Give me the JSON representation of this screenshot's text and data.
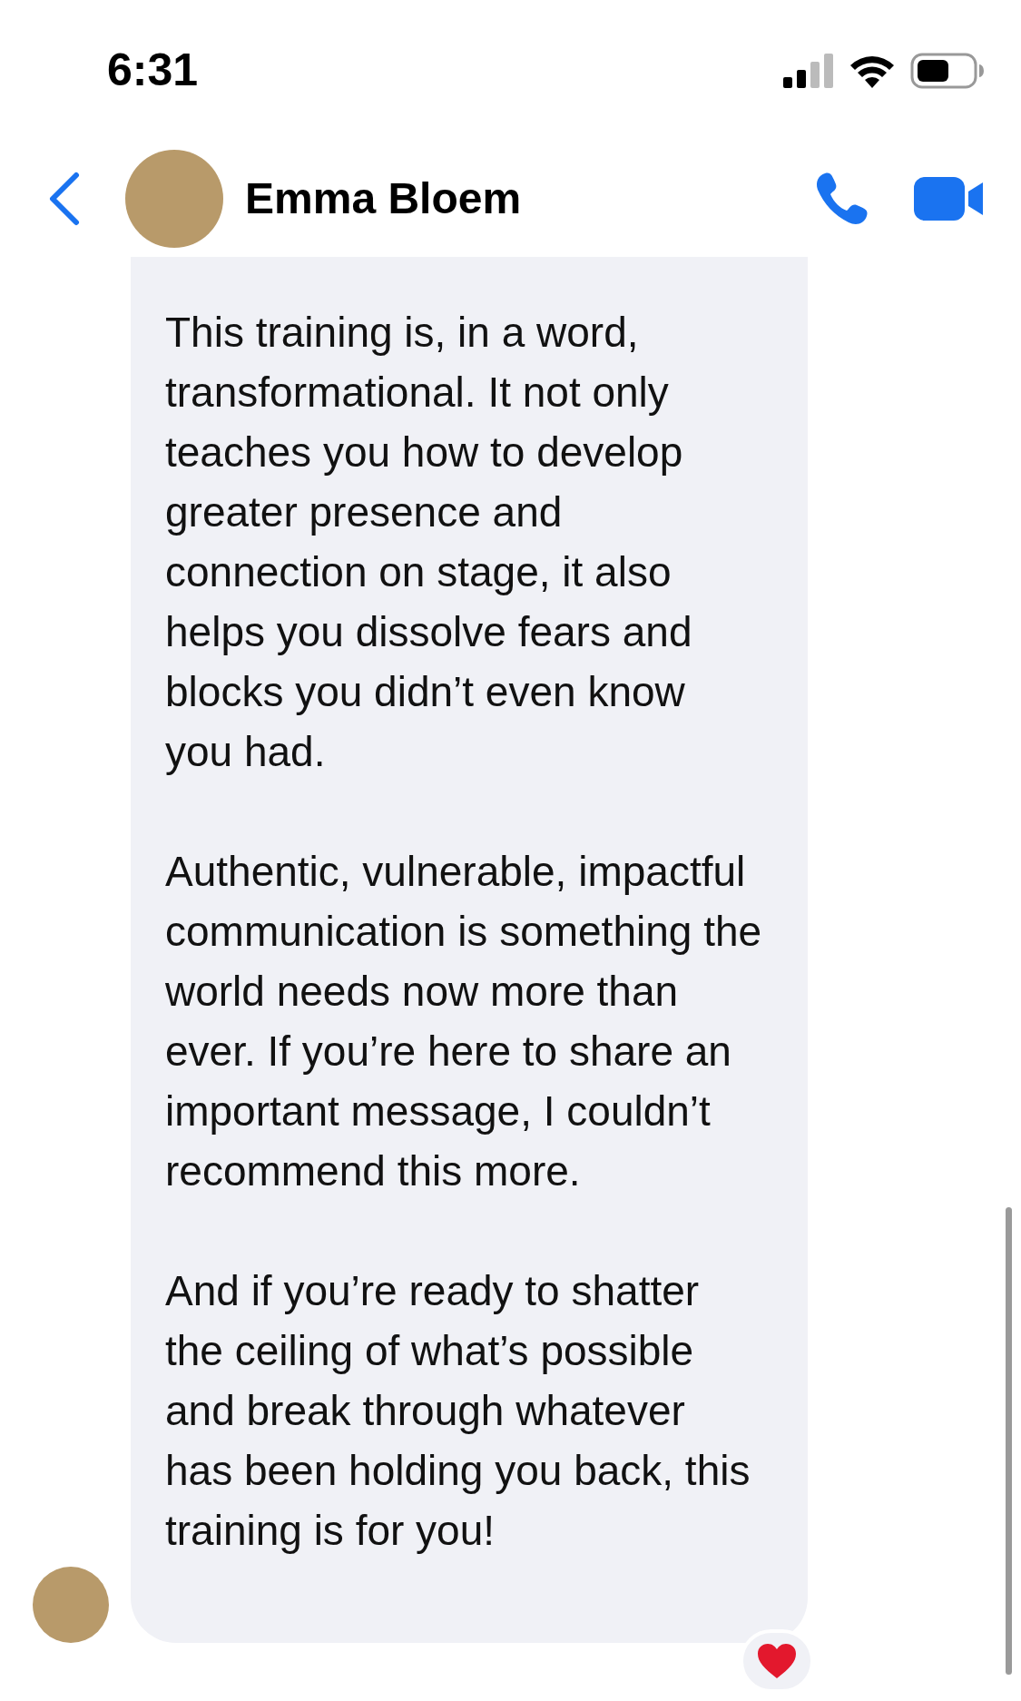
{
  "status_bar": {
    "time": "6:31"
  },
  "header": {
    "contact_name": "Emma Bloem"
  },
  "messages": [
    {
      "kind": "incoming",
      "paragraphs": [
        "This training is, in a word, transformational. It not only teaches you how to develop greater presence and connection on stage, it also helps you dissolve fears and blocks you didn’t even know you had.",
        "Authentic, vulnerable, impactful communication is something the world needs now more than ever. If you’re here to share an important message, I couldn’t recommend this more.",
        "And if you’re ready to shatter the ceiling of what’s possible and break through whatever has been holding you back, this training is for you!"
      ],
      "reaction": {
        "kind": "heart"
      }
    }
  ]
}
